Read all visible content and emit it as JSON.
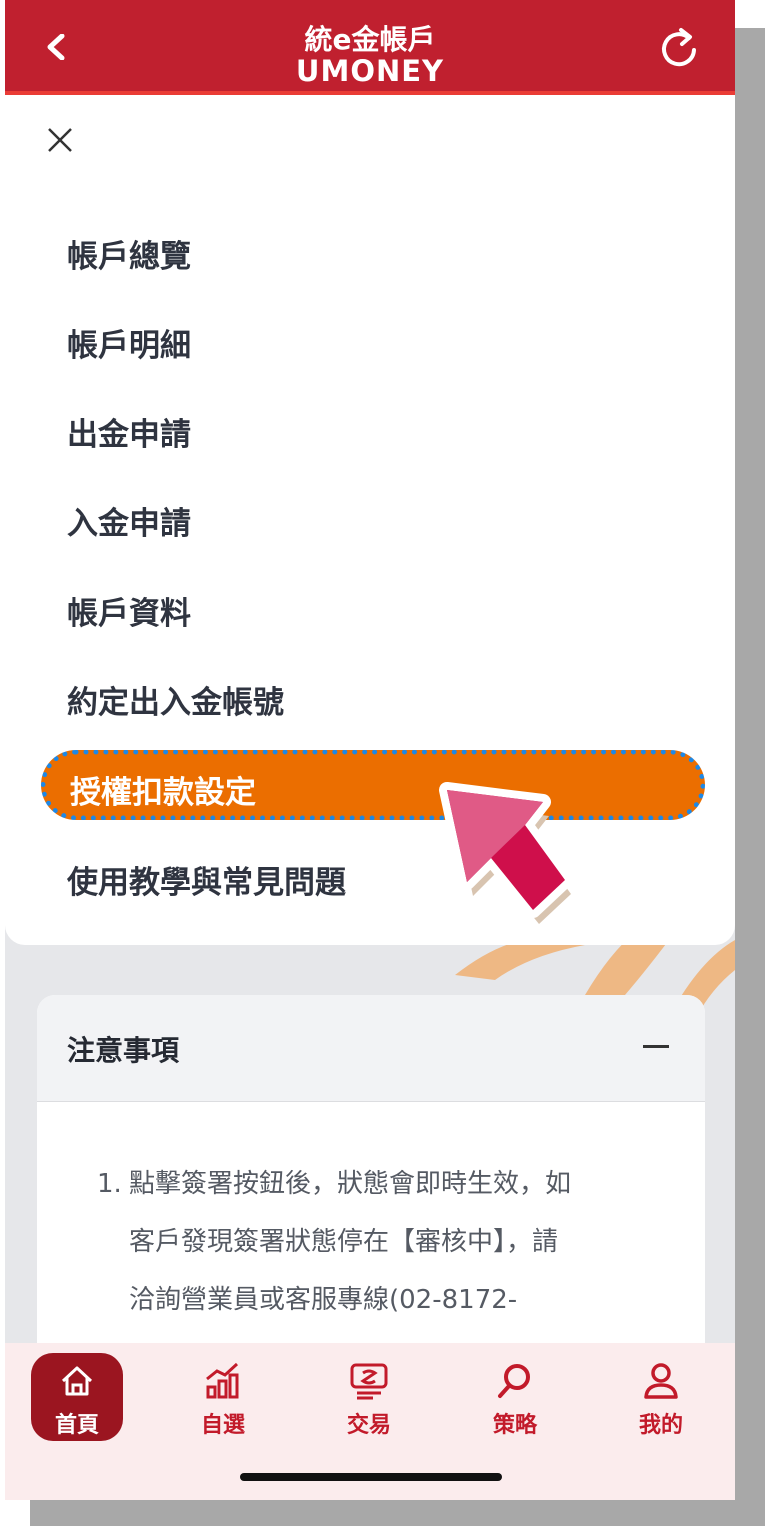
{
  "header": {
    "title_line1": "統e金帳戶",
    "title_line2": "UMONEY",
    "back_icon": "chevron-left-icon",
    "refresh_icon": "refresh-icon"
  },
  "drawer": {
    "close_icon": "close-icon",
    "items": [
      {
        "label": "帳戶總覽"
      },
      {
        "label": "帳戶明細"
      },
      {
        "label": "出金申請"
      },
      {
        "label": "入金申請"
      },
      {
        "label": "帳戶資料"
      },
      {
        "label": "約定出入金帳號"
      },
      {
        "label": "授權扣款設定"
      },
      {
        "label": "使用教學與常見問題"
      }
    ],
    "highlighted_index": 6
  },
  "notice": {
    "title": "注意事項",
    "toggle": "—",
    "item_number": "1.",
    "lines": [
      "點擊簽署按鈕後，狀態會即時生效，如",
      "客戶發現簽署狀態停在【審核中】，請",
      "洽詢營業員或客服專線(02-8172-"
    ]
  },
  "bottom_nav": {
    "items": [
      {
        "label": "首頁",
        "icon": "home-icon",
        "active": true
      },
      {
        "label": "自選",
        "icon": "chart-icon",
        "active": false
      },
      {
        "label": "交易",
        "icon": "trade-icon",
        "active": false
      },
      {
        "label": "策略",
        "icon": "search-icon",
        "active": false
      },
      {
        "label": "我的",
        "icon": "user-icon",
        "active": false
      }
    ]
  },
  "colors": {
    "header": "#c0202f",
    "highlight": "#eb6e00",
    "highlight_border": "#1e88e5",
    "nav_active": "#9b1520",
    "nav_text": "#c21a2a"
  }
}
